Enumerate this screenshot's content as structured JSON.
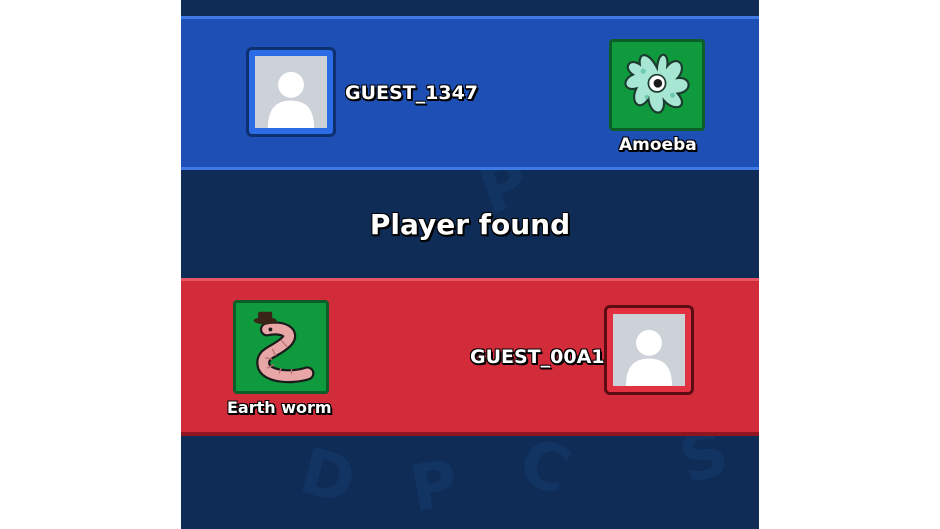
{
  "status_title": "Player found",
  "team_blue": {
    "player": {
      "name": "GUEST_1347",
      "avatar_icon": "default-profile-icon"
    },
    "monster": {
      "name": "Amoeba",
      "icon": "amoeba-icon"
    }
  },
  "team_red": {
    "player": {
      "name": "GUEST_00A1",
      "avatar_icon": "default-profile-icon"
    },
    "monster": {
      "name": "Earth worm",
      "icon": "earthworm-icon"
    }
  },
  "colors": {
    "background": "#0f2c57",
    "blue_band": "#1e4fb5",
    "red_band": "#d22b3a",
    "monster_tile": "#0f9a3e"
  }
}
